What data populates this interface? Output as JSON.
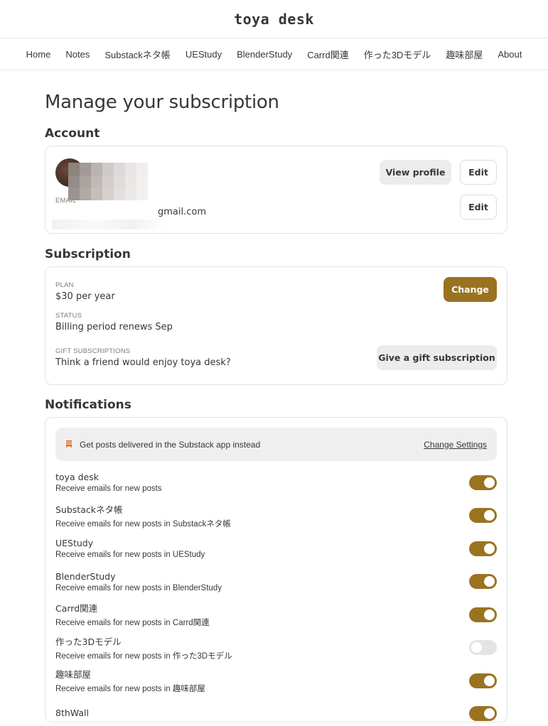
{
  "site": {
    "title": "toya desk"
  },
  "nav": [
    "Home",
    "Notes",
    "Substackネタ帳",
    "UEStudy",
    "BlenderStudy",
    "Carrd関連",
    "作った3Dモデル",
    "趣味部屋",
    "About"
  ],
  "page": {
    "title": "Manage your subscription"
  },
  "account": {
    "section_title": "Account",
    "view_profile": "View profile",
    "edit": "Edit",
    "email_label": "EMAIL",
    "email_value": "gmail.com",
    "edit_email": "Edit"
  },
  "subscription": {
    "section_title": "Subscription",
    "plan_label": "PLAN",
    "plan_value": "$30 per year",
    "change": "Change",
    "status_label": "STATUS",
    "status_value": "Billing period renews Sep",
    "gift_label": "GIFT SUBSCRIPTIONS",
    "gift_value": "Think a friend would enjoy toya desk?",
    "gift_button": "Give a gift subscription"
  },
  "notifications": {
    "section_title": "Notifications",
    "banner_text": "Get posts delivered in the Substack app instead",
    "banner_link": "Change Settings",
    "items": [
      {
        "name": "toya desk",
        "desc": "Receive emails for new posts",
        "on": true
      },
      {
        "name": "Substackネタ帳",
        "desc": "Receive emails for new posts in Substackネタ帳",
        "on": true
      },
      {
        "name": "UEStudy",
        "desc": "Receive emails for new posts in UEStudy",
        "on": true
      },
      {
        "name": "BlenderStudy",
        "desc": "Receive emails for new posts in BlenderStudy",
        "on": true
      },
      {
        "name": "Carrd関連",
        "desc": "Receive emails for new posts in Carrd関連",
        "on": true
      },
      {
        "name": "作った3Dモデル",
        "desc": "Receive emails for new posts in 作った3Dモデル",
        "on": false
      },
      {
        "name": "趣味部屋",
        "desc": "Receive emails for new posts in 趣味部屋",
        "on": true
      },
      {
        "name": "8thWall",
        "desc": "",
        "on": true
      }
    ]
  },
  "colors": {
    "brand": "#9a7320",
    "banner_icon": "#e8661f"
  },
  "icons": {
    "banner": "substack-bookmark-icon"
  }
}
